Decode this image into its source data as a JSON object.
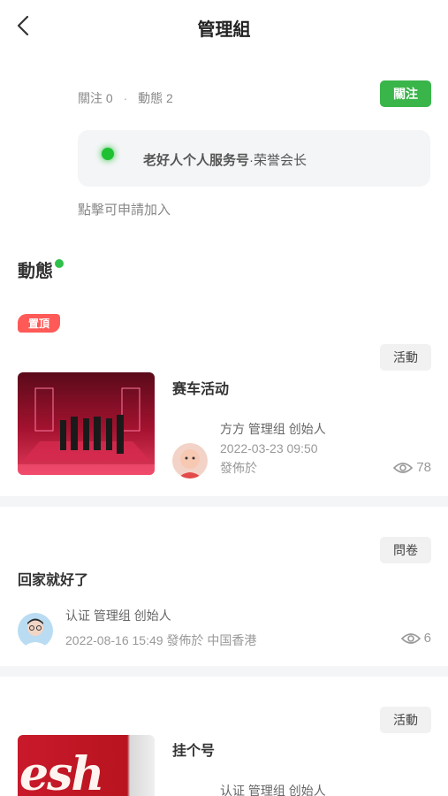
{
  "header": {
    "title": "管理組"
  },
  "stats": {
    "follow_label": "關注",
    "follow_count": "0",
    "separator": "·",
    "dynamic_label": "動態",
    "dynamic_count": "2"
  },
  "follow_button": "關注",
  "member": {
    "name": "老好人个人服务号",
    "role": "·荣誉会长"
  },
  "join_hint": "點擊可申請加入",
  "section_title": "動態",
  "pin_label": "置頂",
  "posts": [
    {
      "tag": "活動",
      "title": "赛车活动",
      "author": "方方 管理组 创始人",
      "datetime": "2022-03-23 09:50",
      "action": "發佈於",
      "views": "78"
    },
    {
      "tag": "問卷",
      "title": "回家就好了",
      "author": "认证 管理组 创始人",
      "datetime": "2022-08-16 15:49",
      "action": "發佈於",
      "location": "中国香港",
      "views": "6"
    },
    {
      "tag": "活動",
      "title": "挂个号",
      "author": "认证 管理组 创始人"
    }
  ],
  "thumb3_text": "esh",
  "colors": {
    "accent_green": "#39b549",
    "online_green": "#1fc132",
    "pin_red": "#ff5a57"
  }
}
